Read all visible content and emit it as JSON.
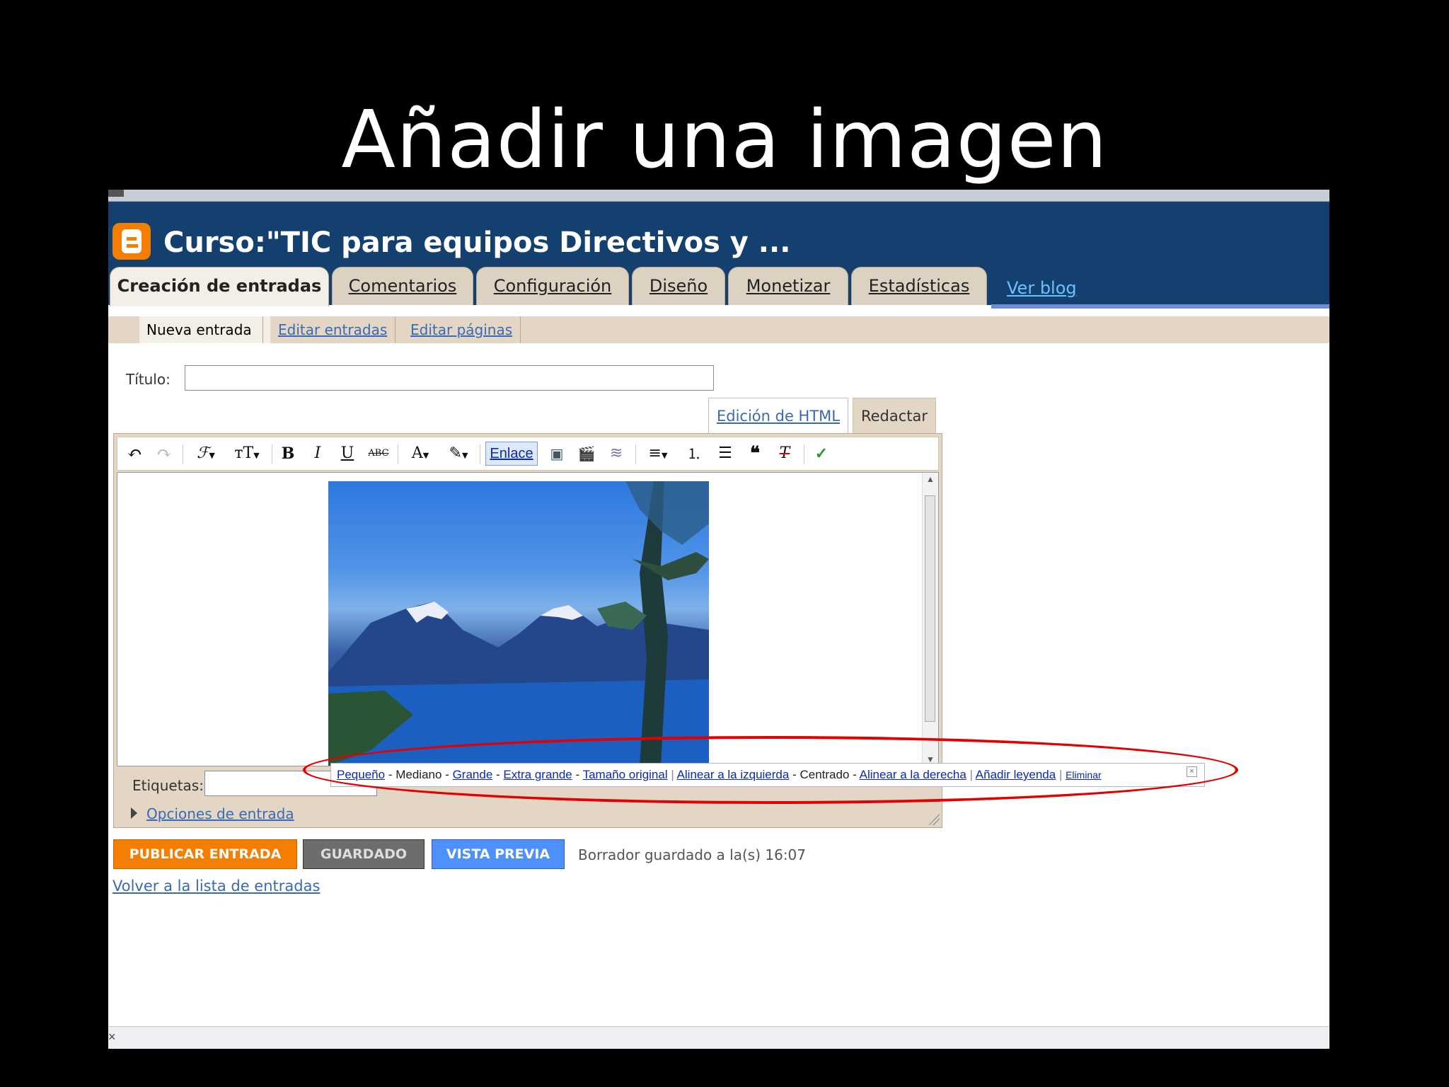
{
  "slide": {
    "title": "Añadir una imagen"
  },
  "blog": {
    "title": "Curso:\"TIC para equipos Directivos y ..."
  },
  "tabs": [
    {
      "label": "Creación de entradas"
    },
    {
      "label": "Comentarios"
    },
    {
      "label": "Configuración"
    },
    {
      "label": "Diseño"
    },
    {
      "label": "Monetizar"
    },
    {
      "label": "Estadísticas"
    }
  ],
  "ver_blog": "Ver blog",
  "subnav": [
    {
      "label": "Nueva entrada"
    },
    {
      "label": "Editar entradas"
    },
    {
      "label": "Editar páginas"
    }
  ],
  "form": {
    "titulo_label": "Título:",
    "titulo_value": "",
    "etiquetas_label": "Etiquetas:",
    "etiquetas_value": "",
    "opciones": "Opciones de entrada"
  },
  "editor": {
    "mode_html": "Edición de HTML",
    "mode_compose": "Redactar",
    "toolbar": {
      "undo": "↶",
      "redo": "↷",
      "font": "ℱ",
      "size": "тT",
      "bold": "B",
      "italic": "I",
      "underline": "U",
      "strike": "ABC",
      "textcolor": "A",
      "highlight": "✎",
      "link": "Enlace",
      "image": "▣",
      "video": "🎬",
      "jump": "≋",
      "align": "≡",
      "ol": "⒈",
      "ul": "☰",
      "quote": "❝",
      "clear": "T",
      "spell": "✓"
    }
  },
  "image_popup": {
    "small": "Pequeño",
    "medium": "Mediano",
    "large": "Grande",
    "xlarge": "Extra grande",
    "original": "Tamaño original",
    "align_left": "Alinear a la izquierda",
    "center": "Centrado",
    "align_right": "Alinear a la derecha",
    "caption": "Añadir leyenda",
    "remove": "Eliminar",
    "dash": "-",
    "sep": "|"
  },
  "buttons": {
    "publish": "PUBLICAR ENTRADA",
    "saved": "GUARDADO",
    "preview": "VISTA PREVIA"
  },
  "status": "Borrador guardado a la(s) 16:07",
  "volver": "Volver a la lista de entradas",
  "colors": {
    "banner": "#13406e",
    "publish": "#f57d00",
    "saved": "#6d6d6d",
    "preview": "#4d90fe",
    "highlight_ellipse": "#e40000"
  }
}
